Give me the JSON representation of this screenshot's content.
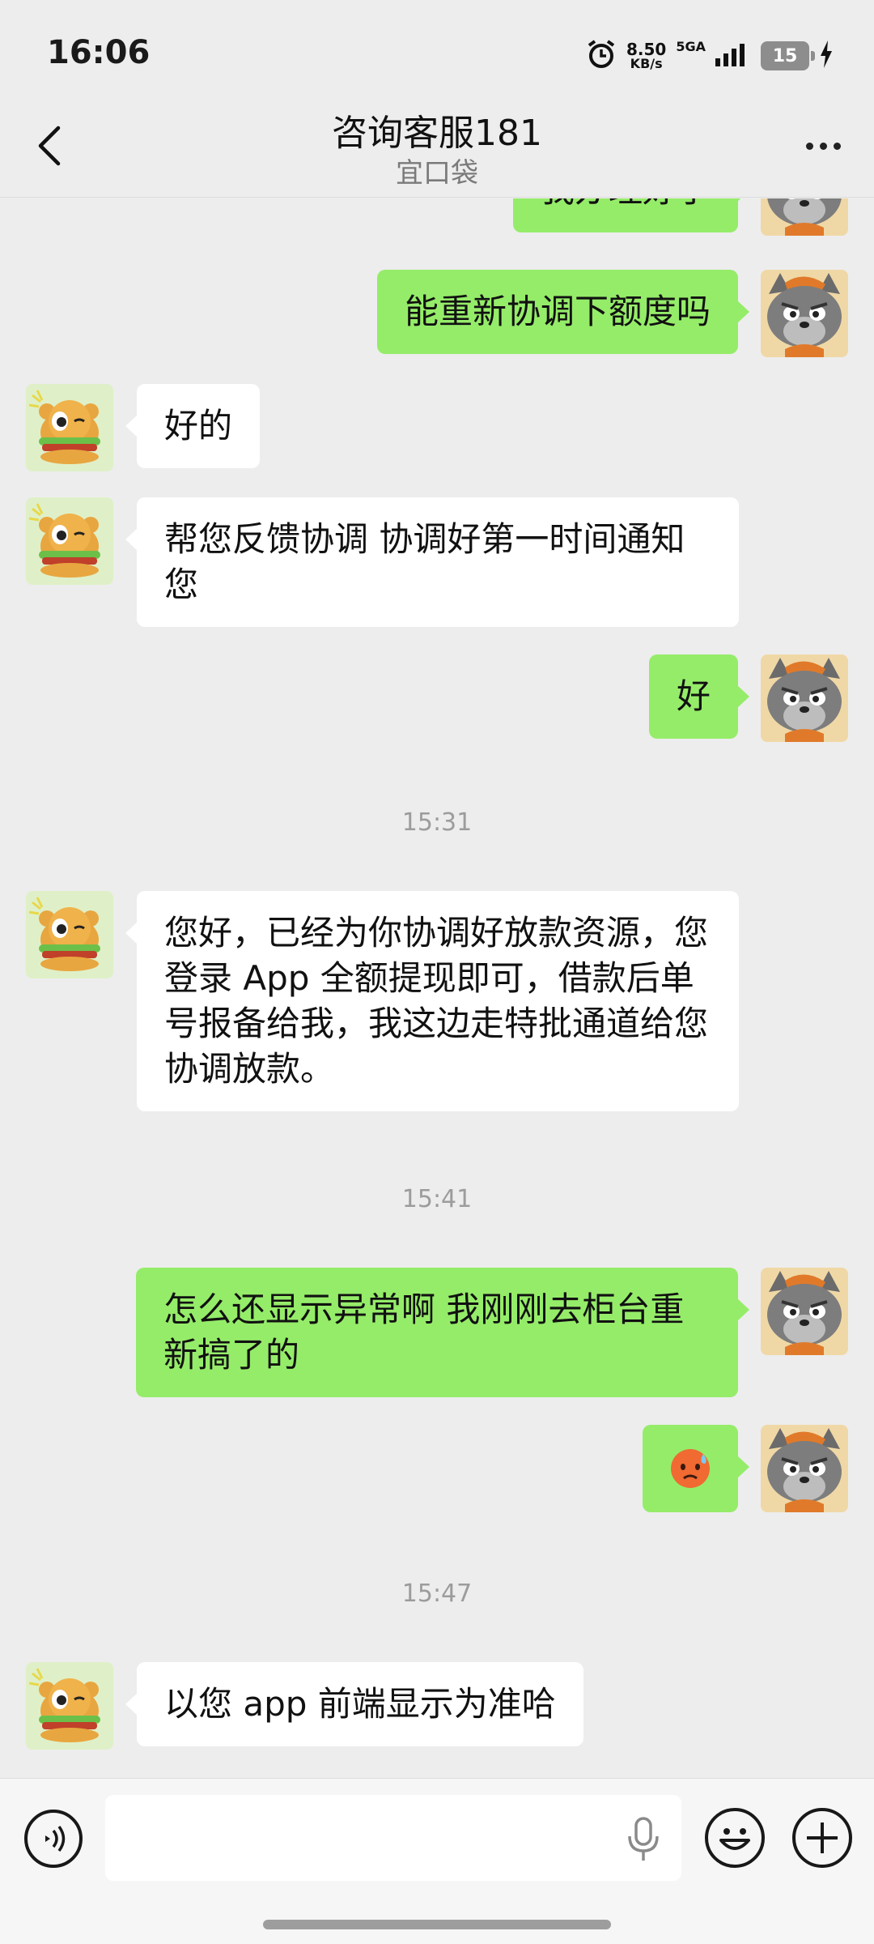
{
  "status_bar": {
    "time": "16:06",
    "net_speed_value": "8.50",
    "net_speed_unit": "KB/s",
    "network": "5GA",
    "battery": "15",
    "icons": [
      "alarm-icon",
      "signal-icon",
      "battery-icon",
      "charging-icon"
    ]
  },
  "header": {
    "title": "咨询客服181",
    "subtitle": "宜口袋",
    "icons": [
      "back-icon",
      "more-icon"
    ]
  },
  "messages": [
    {
      "side": "out",
      "text": "我办理好了"
    },
    {
      "side": "out",
      "text": "能重新协调下额度吗"
    },
    {
      "side": "in",
      "text": "好的"
    },
    {
      "side": "in",
      "text": "帮您反馈协调 协调好第一时间通知您"
    },
    {
      "side": "out",
      "text": "好"
    },
    {
      "type": "time",
      "text": "15:31"
    },
    {
      "side": "in",
      "text": "您好，已经为你协调好放款资源，您登录 App 全额提现即可，借款后单号报备给我，我这边走特批通道给您协调放款。"
    },
    {
      "type": "time",
      "text": "15:41"
    },
    {
      "side": "out",
      "text": "怎么还显示异常啊 我刚刚去柜台重新搞了的"
    },
    {
      "side": "out",
      "type": "emoji",
      "emoji": "sweat-emoji"
    },
    {
      "type": "time",
      "text": "15:47"
    },
    {
      "side": "in",
      "text": "以您 app 前端显示为准哈"
    }
  ],
  "input_bar": {
    "placeholder": "",
    "icons": [
      "voice-icon",
      "mic-icon",
      "emoji-icon",
      "plus-icon"
    ]
  },
  "colors": {
    "background": "#ededed",
    "outgoing_bubble": "#95ec69",
    "incoming_bubble": "#ffffff",
    "timestamp": "#9c9c9c"
  }
}
